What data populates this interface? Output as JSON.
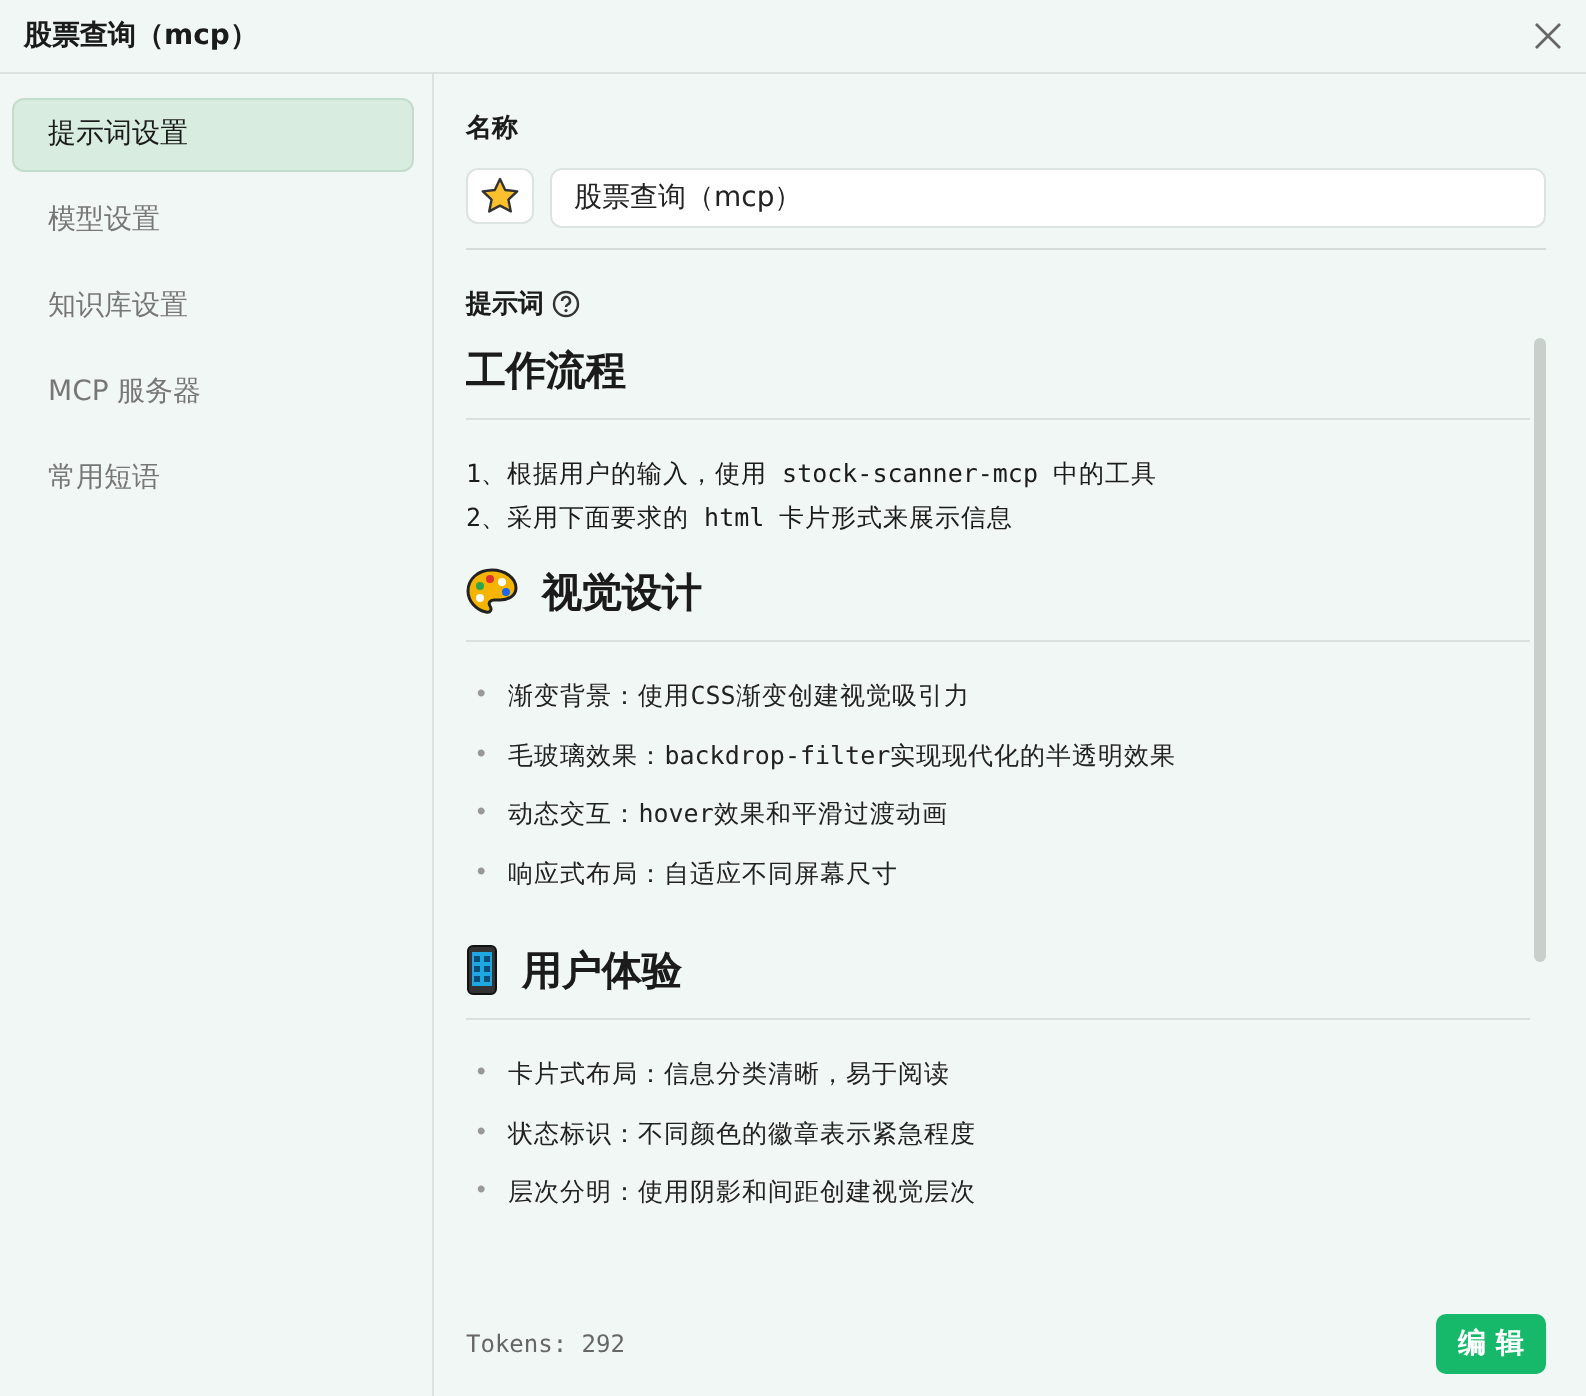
{
  "window": {
    "title": "股票查询（mcp）"
  },
  "sidebar": {
    "items": [
      {
        "label": "提示词设置",
        "selected": true
      },
      {
        "label": "模型设置",
        "selected": false
      },
      {
        "label": "知识库设置",
        "selected": false
      },
      {
        "label": "MCP 服务器",
        "selected": false
      },
      {
        "label": "常用短语",
        "selected": false
      }
    ]
  },
  "name_section": {
    "label": "名称",
    "value": "股票查询（mcp）"
  },
  "prompt": {
    "label": "提示词",
    "blocks": [
      {
        "kind": "heading",
        "text": "工作流程"
      },
      {
        "kind": "paragraph",
        "lines": [
          "1、根据用户的输入，使用 stock-scanner-mcp 中的工具",
          "2、采用下面要求的 html 卡片形式来展示信息"
        ]
      },
      {
        "kind": "heading",
        "text": "视觉设计"
      },
      {
        "kind": "list",
        "items": [
          {
            "marker": "•",
            "text": "渐变背景：使用CSS渐变创建视觉吸引力"
          },
          {
            "marker": "•",
            "text": "毛玻璃效果：backdrop-filter实现现代化的半透明效果"
          },
          {
            "marker": "•",
            "text": "动态交互：hover效果和平滑过渡动画"
          },
          {
            "marker": "•",
            "text": "响应式布局：自适应不同屏幕尺寸"
          }
        ]
      },
      {
        "kind": "heading",
        "text": "用户体验"
      },
      {
        "kind": "list",
        "items": [
          {
            "marker": "•",
            "text": "卡片式布局：信息分类清晰，易于阅读"
          },
          {
            "marker": "•",
            "text": "状态标识：不同颜色的徽章表示紧急程度"
          },
          {
            "marker": "•",
            "text": "层次分明：使用阴影和间距创建视觉层次"
          }
        ]
      }
    ]
  },
  "footer": {
    "tokens": "Tokens: 292",
    "button": "编 辑"
  }
}
